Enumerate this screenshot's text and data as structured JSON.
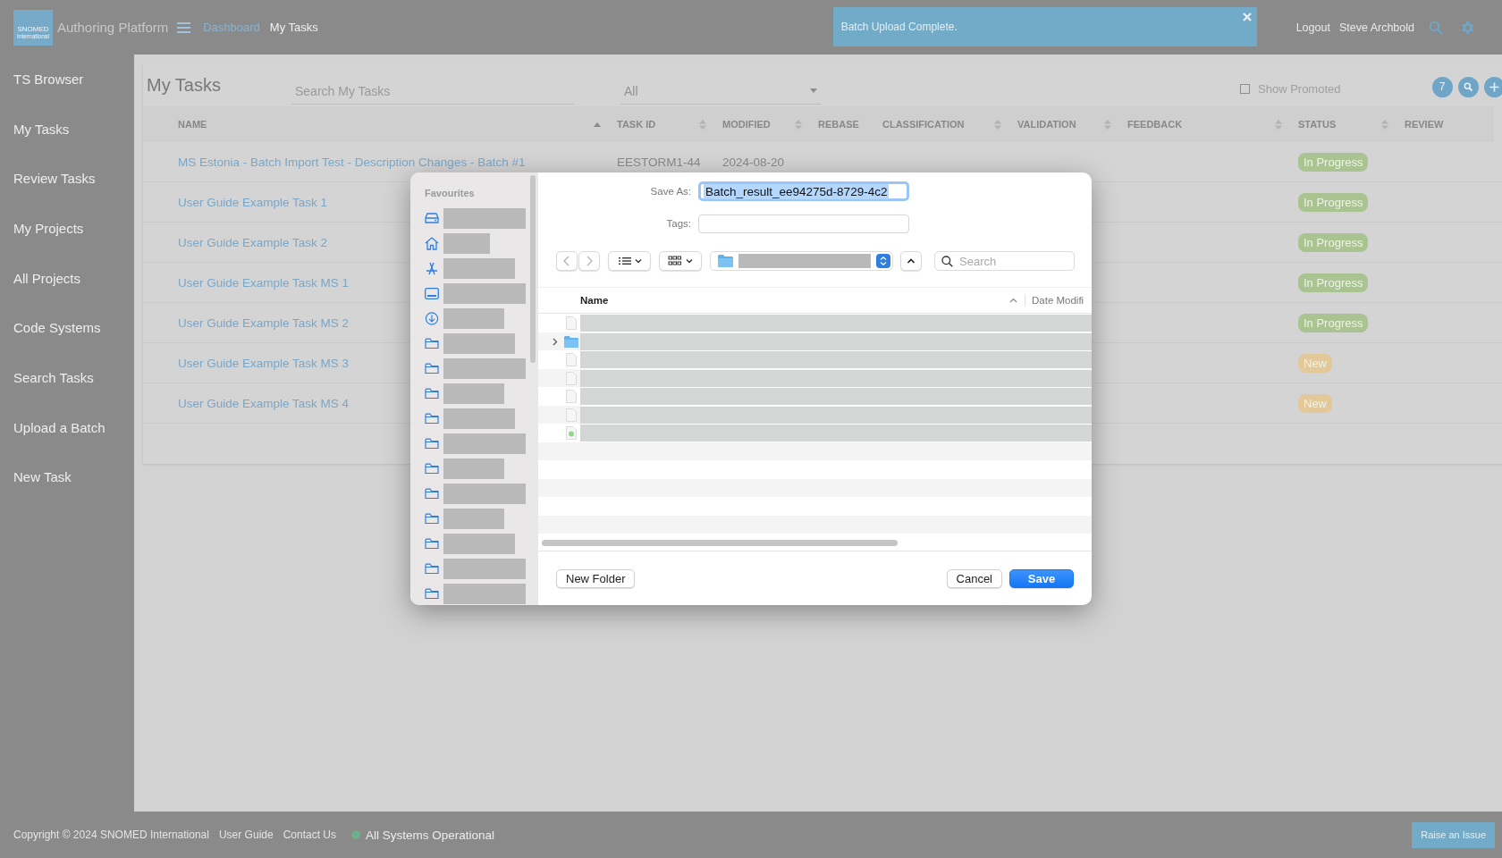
{
  "header": {
    "logo": {
      "line1": "SNOMED",
      "line2": "International"
    },
    "app_title": "Authoring Platform",
    "breadcrumbs": [
      {
        "label": "Dashboard",
        "kind": "link"
      },
      {
        "label": "My Tasks",
        "kind": "current"
      }
    ],
    "notification": "Batch Upload Complete.",
    "logout": "Logout",
    "user": "Steve Archbold"
  },
  "sidebar": {
    "items": [
      {
        "label": "TS Browser"
      },
      {
        "label": "My Tasks"
      },
      {
        "label": "Review Tasks"
      },
      {
        "label": "My Projects"
      },
      {
        "label": "All Projects"
      },
      {
        "label": "Code Systems"
      },
      {
        "label": "Search Tasks"
      },
      {
        "label": "Upload a Batch"
      },
      {
        "label": "New Task"
      }
    ]
  },
  "tasks": {
    "title": "My Tasks",
    "search_placeholder": "Search My Tasks",
    "filter": "All",
    "show_promoted": {
      "label": "Show Promoted",
      "checked": false
    },
    "count": "7",
    "columns": [
      {
        "label": "NAME",
        "kind": "ascending"
      },
      {
        "label": "TASK ID",
        "kind": "sortable"
      },
      {
        "label": "MODIFIED",
        "kind": "sortable"
      },
      {
        "label": "REBASE",
        "kind": "plain"
      },
      {
        "label": "CLASSIFICATION",
        "kind": "sortable"
      },
      {
        "label": "VALIDATION",
        "kind": "sortable"
      },
      {
        "label": "FEEDBACK",
        "kind": "sortable"
      },
      {
        "label": "STATUS",
        "kind": "sortable"
      },
      {
        "label": "REVIEW",
        "kind": "plain"
      }
    ],
    "rows": [
      {
        "name": "MS Estonia - Batch Import Test - Description Changes - Batch #1",
        "task_id": "EESTORM1-44",
        "modified": "2024-08-20",
        "status": "In Progress",
        "color": "#a9c490"
      },
      {
        "name": "User Guide Example Task 1",
        "status": "In Progress",
        "color": "#a9c490"
      },
      {
        "name": "User Guide Example Task 2",
        "status": "In Progress",
        "color": "#a9c490"
      },
      {
        "name": "User Guide Example Task MS 1",
        "status": "In Progress",
        "color": "#a9c490"
      },
      {
        "name": "User Guide Example Task MS 2",
        "status": "In Progress",
        "color": "#a9c490"
      },
      {
        "name": "User Guide Example Task MS 3",
        "status": "New",
        "color": "#e3c89a"
      },
      {
        "name": "User Guide Example Task MS 4",
        "status": "New",
        "color": "#e3c89a"
      }
    ]
  },
  "save_dialog": {
    "favourites_heading": "Favourites",
    "favourites": [
      {
        "kind": "drive"
      },
      {
        "kind": "home"
      },
      {
        "kind": "apps"
      },
      {
        "kind": "display"
      },
      {
        "kind": "download"
      },
      {
        "kind": "folder"
      },
      {
        "kind": "folder"
      },
      {
        "kind": "folder"
      },
      {
        "kind": "folder"
      },
      {
        "kind": "folder"
      },
      {
        "kind": "folder"
      },
      {
        "kind": "folder"
      },
      {
        "kind": "folder"
      },
      {
        "kind": "folder"
      },
      {
        "kind": "folder"
      },
      {
        "kind": "folder"
      }
    ],
    "save_as_label": "Save As:",
    "save_as_value": "Batch_result_ee94275d-8729-4c2",
    "tags_label": "Tags:",
    "search_placeholder": "Search",
    "columns": [
      {
        "label": "Name"
      },
      {
        "label": "Date Modifi"
      }
    ],
    "files": [
      {
        "kind": "file"
      },
      {
        "kind": "folder"
      },
      {
        "kind": "file"
      },
      {
        "kind": "file"
      },
      {
        "kind": "file"
      },
      {
        "kind": "file"
      },
      {
        "kind": "image"
      }
    ],
    "new_folder": "New Folder",
    "cancel": "Cancel",
    "save": "Save"
  },
  "footer": {
    "copyright": "Copyright © 2024 SNOMED International",
    "links": [
      "User Guide",
      "Contact Us"
    ],
    "status": {
      "label": "All Systems Operational",
      "color": "#6fae8a"
    },
    "raise_issue": "Raise an Issue"
  }
}
